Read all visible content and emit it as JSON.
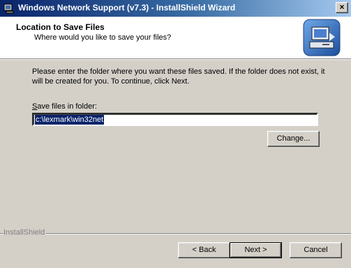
{
  "window": {
    "title": "Windows Network Support (v7.3) - InstallShield Wizard",
    "close_glyph": "×",
    "icon": "installer-icon"
  },
  "header": {
    "title": "Location to Save Files",
    "subtitle": "Where would you like to save your files?",
    "logo_icon": "computer-install-logo"
  },
  "body": {
    "intro_text": "Please enter the folder where you want these files saved.  If the folder does not exist, it will be created for you.   To continue, click Next.",
    "folder_label": "Save files in folder:",
    "folder_value": "c:\\lexmark\\win32net",
    "change_button": "Change..."
  },
  "footer": {
    "brand": "InstallShield",
    "back_button": "< Back",
    "next_button": "Next >",
    "cancel_button": "Cancel"
  },
  "colors": {
    "title_start": "#0a246a",
    "title_end": "#a6caf0",
    "face": "#d4d0c8",
    "selection": "#0a246a"
  }
}
